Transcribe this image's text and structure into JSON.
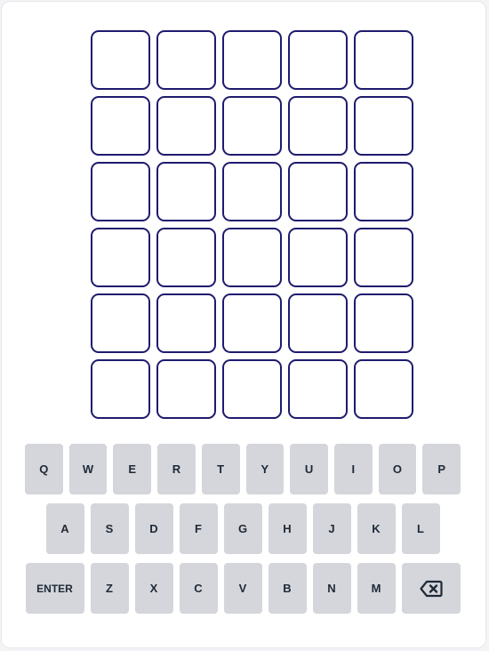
{
  "board": {
    "rows": [
      [
        "",
        "",
        "",
        "",
        ""
      ],
      [
        "",
        "",
        "",
        "",
        ""
      ],
      [
        "",
        "",
        "",
        "",
        ""
      ],
      [
        "",
        "",
        "",
        "",
        ""
      ],
      [
        "",
        "",
        "",
        "",
        ""
      ],
      [
        "",
        "",
        "",
        "",
        ""
      ]
    ],
    "tile_border_color": "#1e1b6e"
  },
  "keyboard": {
    "rows": [
      [
        "Q",
        "W",
        "E",
        "R",
        "T",
        "Y",
        "U",
        "I",
        "O",
        "P"
      ],
      [
        "A",
        "S",
        "D",
        "F",
        "G",
        "H",
        "J",
        "K",
        "L"
      ],
      [
        "ENTER",
        "Z",
        "X",
        "C",
        "V",
        "B",
        "N",
        "M",
        "backspace-icon"
      ]
    ],
    "key_color": "#d4d6db"
  }
}
